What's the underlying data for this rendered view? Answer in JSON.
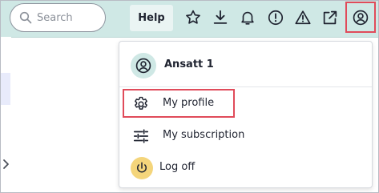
{
  "header": {
    "search_placeholder": "Search",
    "help_label": "Help",
    "icons": [
      "star-icon",
      "download-icon",
      "bell-icon",
      "info-circle-icon",
      "warning-icon",
      "external-link-icon",
      "user-circle-icon"
    ]
  },
  "user_menu": {
    "user_name": "Ansatt 1",
    "items": [
      {
        "label": "My profile",
        "icon": "gear-icon"
      },
      {
        "label": "My subscription",
        "icon": "sliders-icon"
      },
      {
        "label": "Log off",
        "icon": "power-icon"
      }
    ]
  },
  "colors": {
    "header_bg": "#cfe8e5",
    "highlight": "#e04b5a",
    "logoff_icon_bg": "#f4d57b"
  }
}
